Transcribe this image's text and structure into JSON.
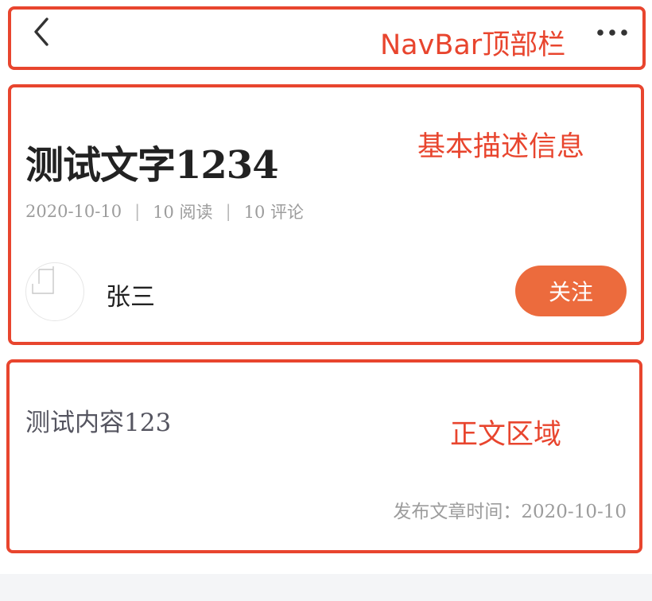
{
  "annotations": {
    "navbar": "NavBar顶部栏",
    "info": "基本描述信息",
    "body": "正文区域"
  },
  "navbar": {
    "back_icon": "chevron-left-icon",
    "more_icon": "more-horizontal-icon"
  },
  "article": {
    "title": "测试文字1234",
    "date": "2020-10-10",
    "reads": "10 阅读",
    "comments": "10 评论",
    "separator": "|"
  },
  "author": {
    "name": "张三",
    "follow_label": "关注"
  },
  "content": {
    "text": "测试内容123",
    "publish_time": "发布文章时间：2020-10-10"
  },
  "colors": {
    "annotation": "#e8452e",
    "accent": "#ec6b3d",
    "title": "#222222",
    "meta": "#9c9c9c"
  }
}
